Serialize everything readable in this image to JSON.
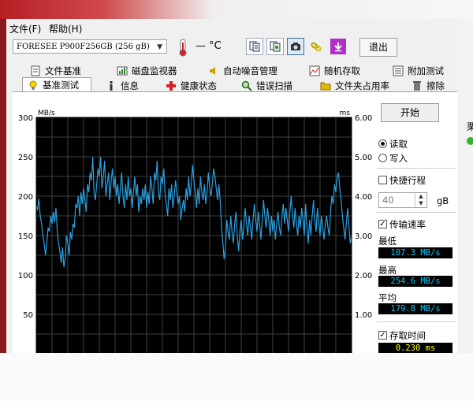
{
  "menu": {
    "file": "文件(F)",
    "help": "帮助(H)"
  },
  "toolbar": {
    "drive": "FORESEE P900F256GB (256 gB)",
    "temperature": "— °C",
    "exit_label": "退出",
    "icons": [
      "copy-text-icon",
      "copy-info-icon",
      "camera-icon",
      "link-icon",
      "save-download-icon"
    ]
  },
  "tabs": {
    "row1": [
      {
        "label": "文件基准",
        "icon": "file-benchmark-icon"
      },
      {
        "label": "磁盘监视器",
        "icon": "disk-monitor-icon"
      },
      {
        "label": "自动噪音管理",
        "icon": "noise-icon"
      },
      {
        "label": "随机存取",
        "icon": "random-access-icon"
      },
      {
        "label": "附加测试",
        "icon": "extra-tests-icon"
      }
    ],
    "row2": [
      {
        "label": "基准测试",
        "icon": "benchmark-icon",
        "active": true
      },
      {
        "label": "信息",
        "icon": "info-icon"
      },
      {
        "label": "健康状态",
        "icon": "health-icon"
      },
      {
        "label": "错误扫描",
        "icon": "error-scan-icon"
      },
      {
        "label": "文件夹占用率",
        "icon": "folder-icon"
      },
      {
        "label": "擦除",
        "icon": "erase-icon"
      }
    ]
  },
  "chart_data": {
    "type": "line",
    "unit_left": "MB/s",
    "unit_right": "ms",
    "y_left_ticks": [
      "300",
      "250",
      "200",
      "150",
      "100",
      "50"
    ],
    "y_right_ticks": [
      "6.00",
      "5.00",
      "4.00",
      "3.00",
      "2.00",
      "1.00"
    ],
    "ylim": [
      0,
      300
    ],
    "y2lim": [
      0,
      6
    ],
    "grid": true,
    "colors": {
      "background": "#000000",
      "grid": "#3f3f3f",
      "line": "#2aa0e0"
    },
    "series": [
      {
        "values": [
          187,
          183,
          197,
          175,
          165,
          150,
          140,
          125,
          140,
          160,
          155,
          175,
          165,
          180,
          167,
          185,
          155,
          140,
          130,
          115,
          135,
          110,
          120,
          150,
          140,
          125,
          155,
          145,
          165,
          160,
          190,
          185,
          200,
          175,
          205,
          190,
          210,
          195,
          180,
          215,
          205,
          230,
          220,
          250,
          205,
          195,
          215,
          235,
          225,
          250,
          210,
          225,
          245,
          200,
          215,
          230,
          195,
          220,
          235,
          210,
          225,
          200,
          215,
          190,
          210,
          230,
          200,
          185,
          215,
          195,
          225,
          200,
          210,
          185,
          205,
          225,
          200,
          215,
          180,
          200,
          190,
          210,
          195,
          215,
          185,
          205,
          190,
          225,
          210,
          190,
          230,
          220,
          245,
          205,
          195,
          225,
          215,
          235,
          205,
          190,
          175,
          210,
          195,
          215,
          185,
          200,
          220,
          205,
          190,
          200,
          170,
          185,
          195,
          180,
          210,
          195,
          225,
          200,
          215,
          240,
          220,
          205,
          185,
          210,
          190,
          225,
          205,
          195,
          215,
          190,
          205,
          230,
          210,
          200,
          215,
          235,
          225,
          210,
          195,
          215,
          195,
          160,
          140,
          120,
          135,
          170,
          155,
          145,
          175,
          155,
          140,
          165,
          180,
          150,
          130,
          155,
          170,
          145,
          160,
          185,
          165,
          150,
          175,
          160,
          145,
          170,
          190,
          170,
          155,
          180,
          165,
          145,
          170,
          195,
          175,
          160,
          185,
          170,
          150,
          175,
          155,
          170,
          145,
          165,
          180,
          160,
          150,
          175,
          190,
          165,
          185,
          170,
          155,
          180,
          200,
          175,
          160,
          185,
          165,
          150,
          175,
          160,
          185,
          170,
          150,
          190,
          160,
          140,
          170,
          150,
          175,
          195,
          170,
          155,
          185,
          165,
          150,
          175,
          160,
          145,
          165,
          175,
          160,
          150,
          180,
          200,
          190,
          215,
          205,
          225,
          230,
          210,
          195,
          175,
          160,
          145,
          165,
          185,
          160,
          140,
          150
        ]
      }
    ]
  },
  "controls": {
    "start_label": "开始",
    "read_label": "读取",
    "write_label": "写入",
    "read_selected": true,
    "short_stroke_label": "快捷行程",
    "short_stroke_checked": false,
    "short_stroke_value": "40",
    "short_stroke_unit": "gB",
    "transfer_rate_label": "传输速率",
    "transfer_rate_checked": true,
    "min_label": "最低",
    "min_value": "107.3 MB/s",
    "max_label": "最高",
    "max_value": "254.6 MB/s",
    "avg_label": "平均",
    "avg_value": "179.8 MB/s",
    "access_time_label": "存取时间",
    "access_time_checked": true,
    "access_time_value": "0.230 ms"
  },
  "background_window": {
    "partial_label": "栗"
  }
}
